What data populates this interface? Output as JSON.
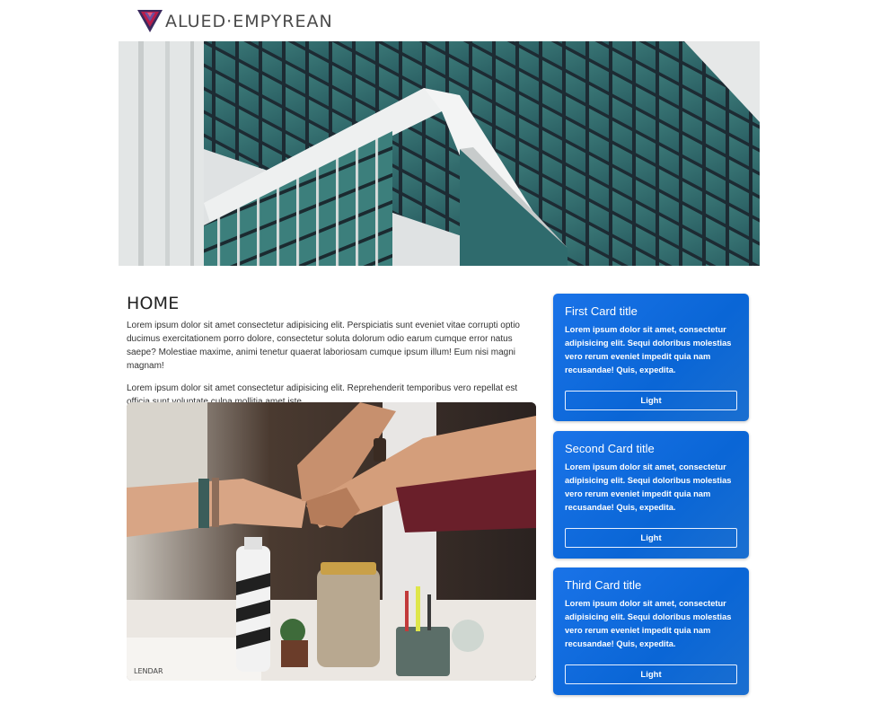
{
  "brand": {
    "name": "ALUED·EMPYREAN",
    "logo_letter": "V"
  },
  "main": {
    "title": "HOME",
    "paragraphs": [
      "Lorem ipsum dolor sit amet consectetur adipisicing elit. Perspiciatis sunt eveniet vitae corrupti optio ducimus exercitationem porro dolore, consectetur soluta dolorum odio earum cumque error natus saepe? Molestiae maxime, animi tenetur quaerat laboriosam cumque ipsum illum! Eum nisi magni magnam!",
      "Lorem ipsum dolor sit amet consectetur adipisicing elit. Reprehenderit temporibus vero repellat est officia sunt voluptate culpa mollitia amet iste."
    ]
  },
  "cards": [
    {
      "title": "First Card title",
      "text": "Lorem ipsum dolor sit amet, consectetur adipisicing elit. Sequi doloribus molestias vero rerum eveniet impedit quia nam recusandae! Quis, expedita.",
      "button": "Light"
    },
    {
      "title": "Second Card title",
      "text": "Lorem ipsum dolor sit amet, consectetur adipisicing elit. Sequi doloribus molestias vero rerum eveniet impedit quia nam recusandae! Quis, expedita.",
      "button": "Light"
    },
    {
      "title": "Third Card title",
      "text": "Lorem ipsum dolor sit amet, consectetur adipisicing elit. Sequi doloribus molestias vero rerum eveniet impedit quia nam recusandae! Quis, expedita.",
      "button": "Light"
    }
  ],
  "colors": {
    "card": "#1a73e8",
    "logo_accent": "#b81d4a",
    "logo_dark": "#3b2a5e"
  },
  "images": {
    "hero": "building-photo",
    "main": "team-fist-bump-photo"
  },
  "photo_label": "LENDAR"
}
